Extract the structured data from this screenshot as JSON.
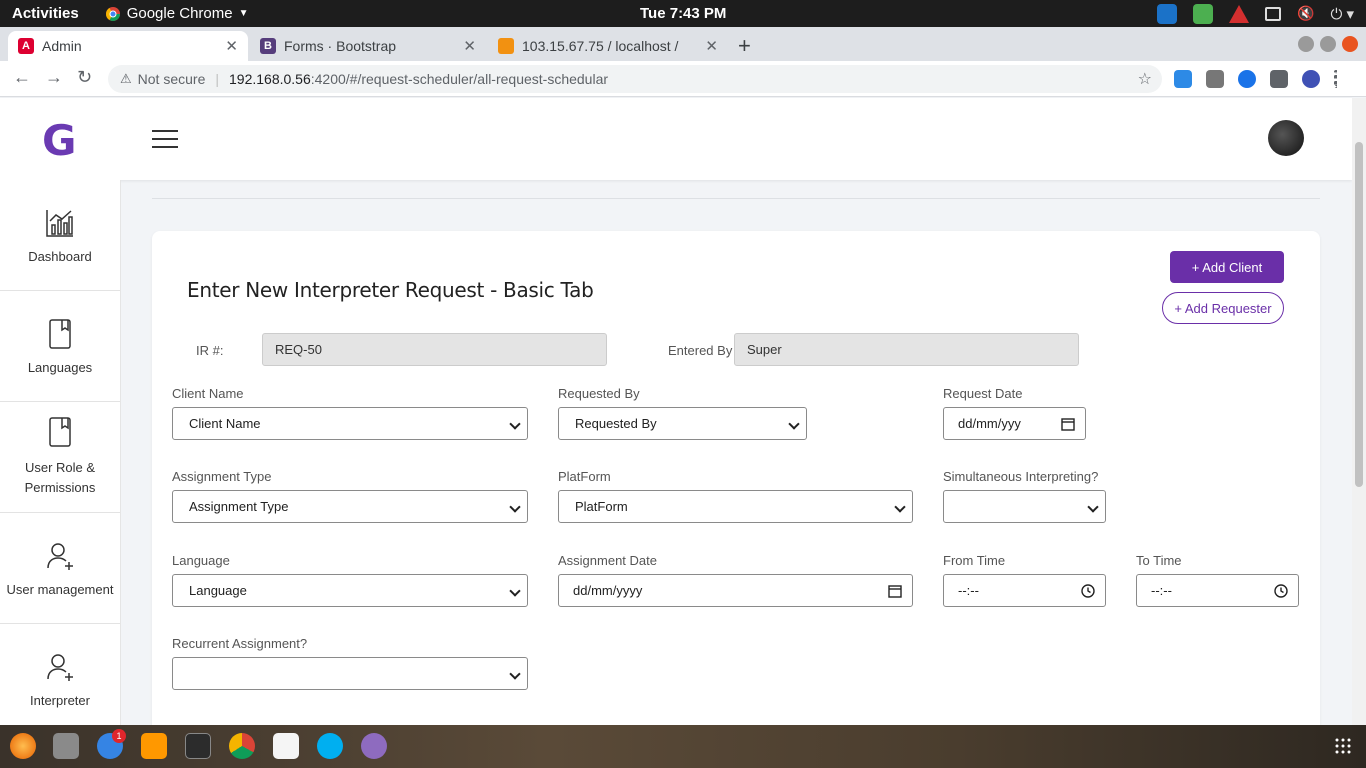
{
  "system": {
    "activities": "Activities",
    "app_name": "Google Chrome",
    "clock": "Tue  7:43 PM"
  },
  "browser": {
    "tabs": [
      {
        "title": "Admin"
      },
      {
        "title": "Forms · Bootstrap"
      },
      {
        "title": "103.15.67.75 / localhost / "
      }
    ],
    "security": "Not secure",
    "url_host": "192.168.0.56",
    "url_path": ":4200/#/request-scheduler/all-request-schedular"
  },
  "header": {
    "logo": "G"
  },
  "sidebar": {
    "items": [
      {
        "label": "Dashboard"
      },
      {
        "label": "Languages"
      },
      {
        "label": "User Role & Permissions"
      },
      {
        "label": "User management"
      },
      {
        "label": "Interpreter"
      }
    ]
  },
  "form": {
    "title": "Enter New Interpreter Request - Basic Tab",
    "add_client": "+ Add Client",
    "add_requester": "+ Add Requester",
    "ir_label": "IR #:",
    "ir_value": "REQ-50",
    "entered_by_label": "Entered By",
    "entered_by_value": "Super",
    "client_name_label": "Client Name",
    "client_name_value": "Client Name",
    "requested_by_label": "Requested By",
    "requested_by_value": "Requested By",
    "request_date_label": "Request Date",
    "request_date_value": "dd/mm/yyy",
    "assignment_type_label": "Assignment Type",
    "assignment_type_value": "Assignment Type",
    "platform_label": "PlatForm",
    "platform_value": "PlatForm",
    "simultaneous_label": "Simultaneous Interpreting?",
    "simultaneous_value": "",
    "language_label": "Language",
    "language_value": "Language",
    "assignment_date_label": "Assignment Date",
    "assignment_date_value": "dd/mm/yyyy",
    "from_time_label": "From Time",
    "from_time_value": "--:--",
    "to_time_label": "To Time",
    "to_time_value": "--:--",
    "recurrent_label": "Recurrent Assignment?",
    "recurrent_value": ""
  },
  "taskbar": {
    "mail_badge": "1"
  },
  "colors": {
    "brand": "#6a2fa8",
    "chrome_tabstrip": "#dee1e6"
  }
}
